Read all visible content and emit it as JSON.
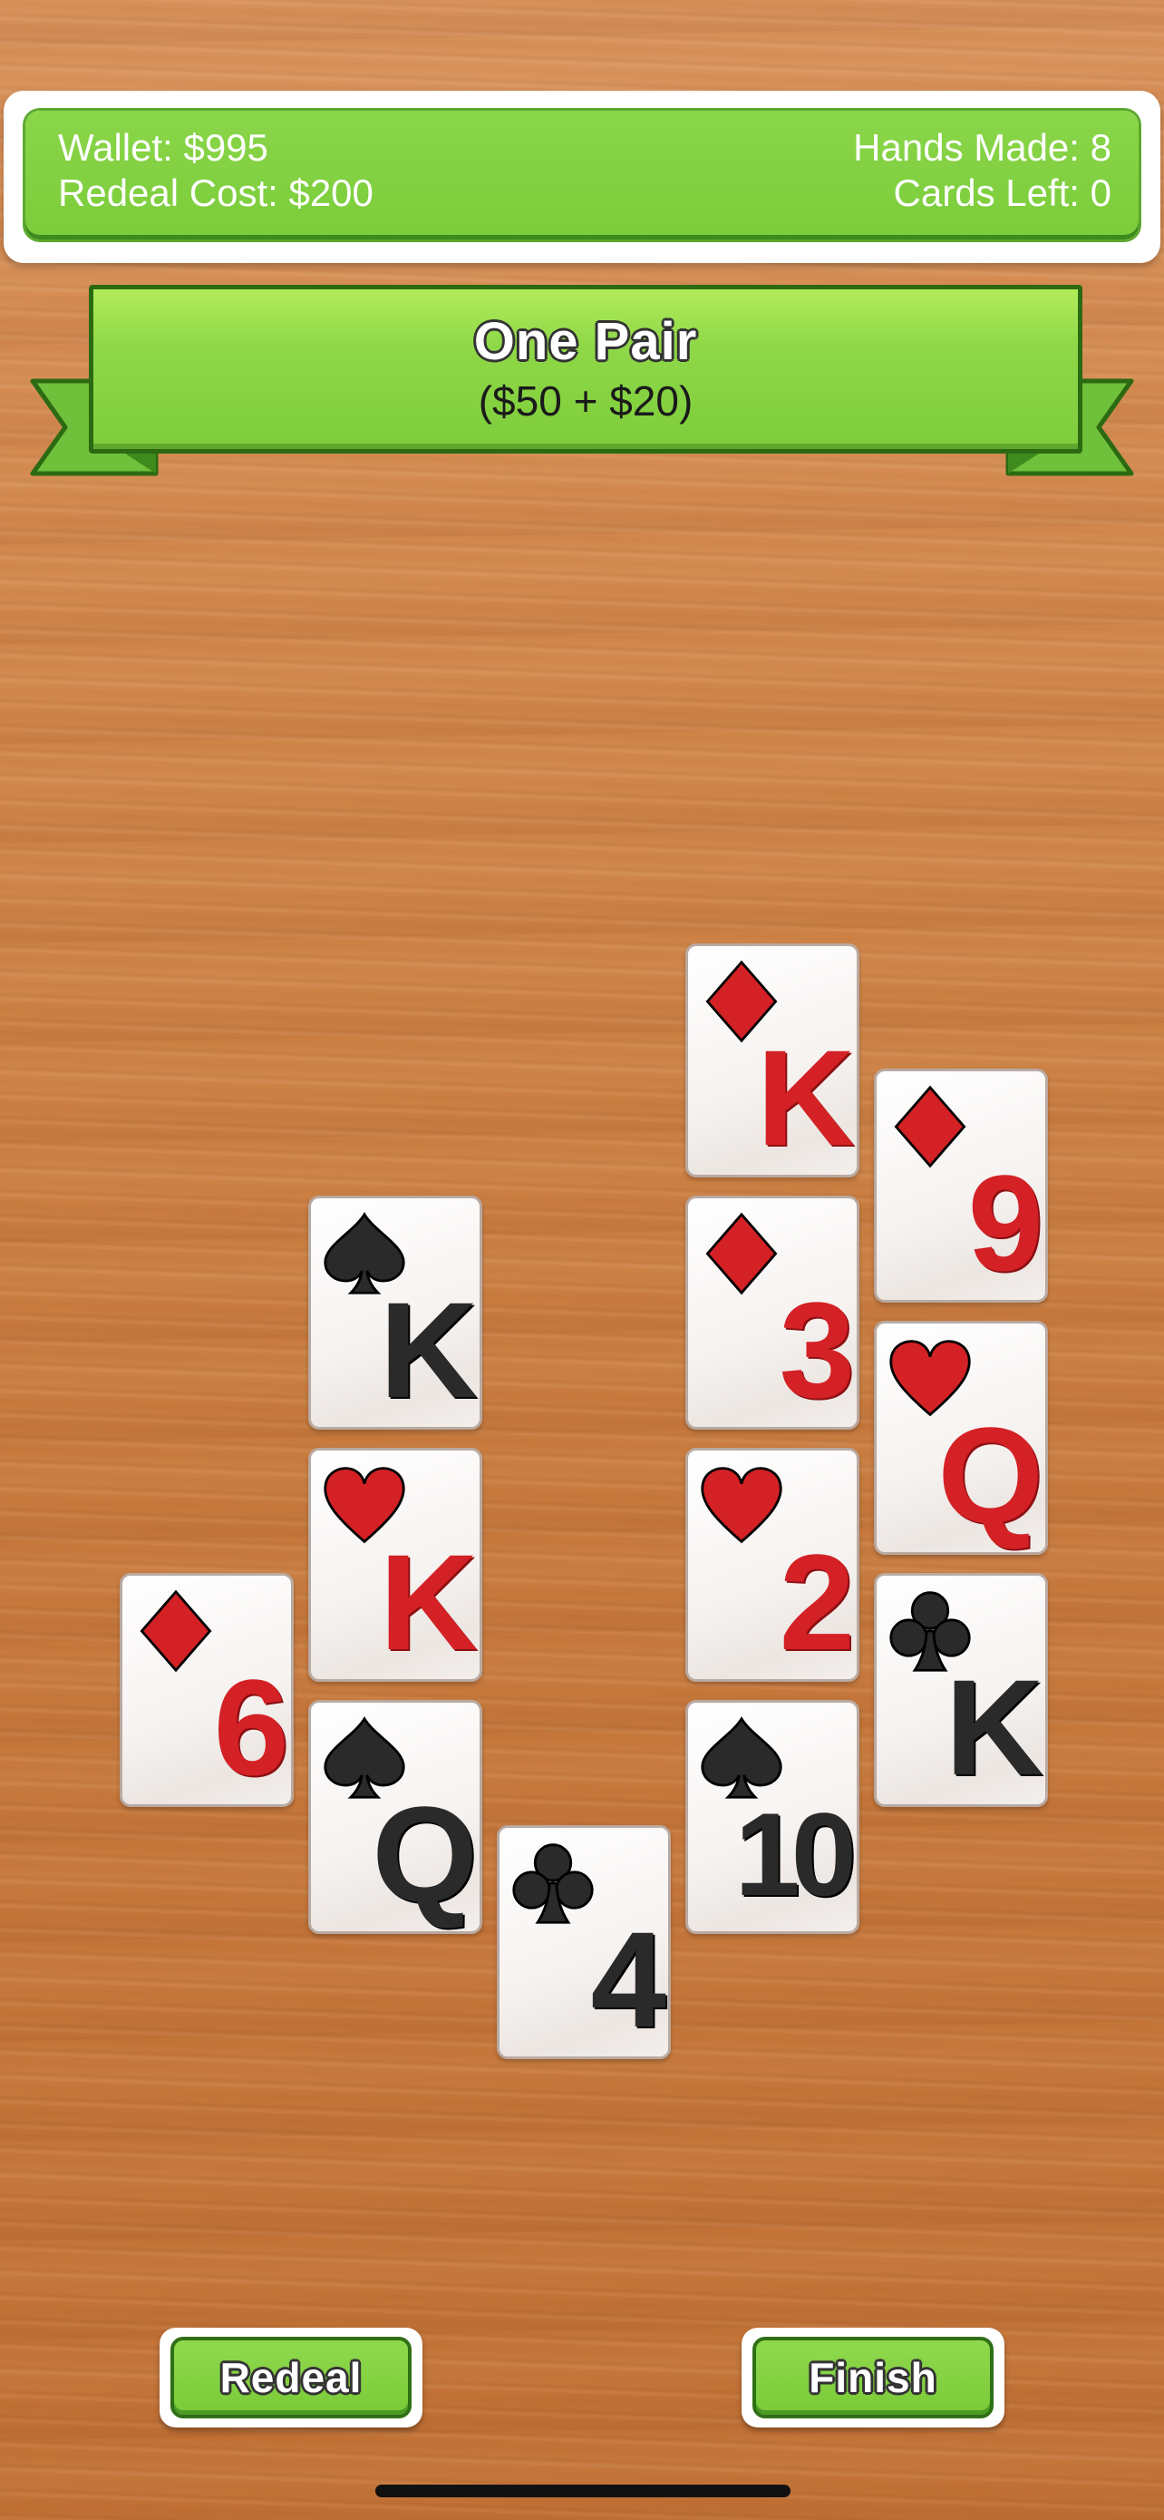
{
  "status": {
    "wallet": "Wallet: $995",
    "redeal_cost": "Redeal Cost: $200",
    "hands_made": "Hands Made: 8",
    "cards_left": "Cards Left: 0"
  },
  "banner": {
    "title": "One Pair",
    "subtitle": "($50 + $20)"
  },
  "cards": [
    {
      "rank": "6",
      "suit": "diamond-icon",
      "color": "red"
    },
    {
      "rank": "K",
      "suit": "spade-icon",
      "color": "black"
    },
    {
      "rank": "K",
      "suit": "heart-icon",
      "color": "red"
    },
    {
      "rank": "Q",
      "suit": "spade-icon",
      "color": "black"
    },
    {
      "rank": "4",
      "suit": "club-icon",
      "color": "black"
    },
    {
      "rank": "K",
      "suit": "diamond-icon",
      "color": "red"
    },
    {
      "rank": "3",
      "suit": "diamond-icon",
      "color": "red"
    },
    {
      "rank": "2",
      "suit": "heart-icon",
      "color": "red"
    },
    {
      "rank": "10",
      "suit": "spade-icon",
      "color": "black"
    },
    {
      "rank": "9",
      "suit": "diamond-icon",
      "color": "red"
    },
    {
      "rank": "Q",
      "suit": "heart-icon",
      "color": "red"
    },
    {
      "rank": "K",
      "suit": "club-icon",
      "color": "black"
    }
  ],
  "buttons": {
    "redeal": "Redeal",
    "finish": "Finish"
  },
  "colors": {
    "accent_green": "#7bcc3a",
    "card_red": "#d42126",
    "card_black": "#2a2a2a"
  }
}
